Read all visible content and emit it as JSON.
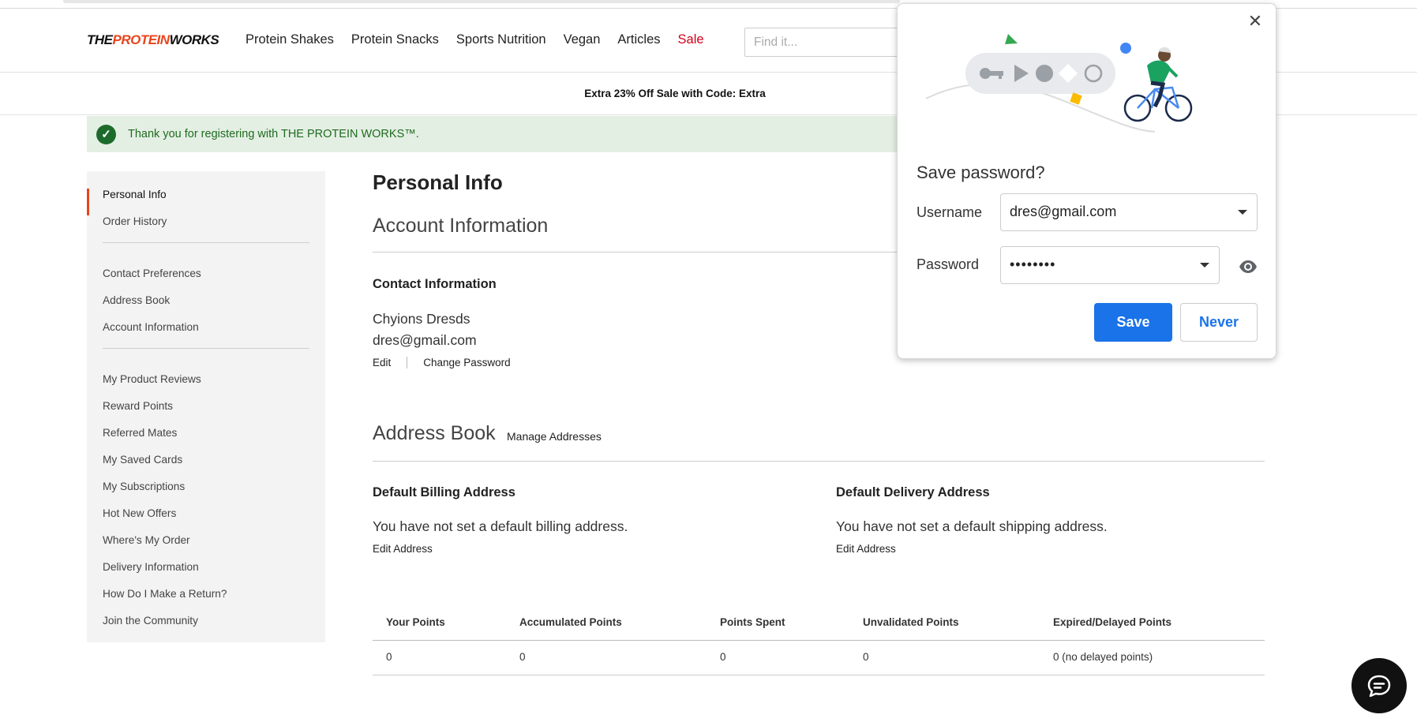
{
  "logo": {
    "part1": "THE",
    "part2": "PROTEIN",
    "part3": "WORKS"
  },
  "nav": {
    "items": [
      "Protein Shakes",
      "Protein Snacks",
      "Sports Nutrition",
      "Vegan",
      "Articles"
    ],
    "sale": "Sale"
  },
  "search": {
    "placeholder": "Find it..."
  },
  "promo": "Extra 23% Off Sale with Code: Extra",
  "success_message": "Thank you for registering with THE PROTEIN WORKS™.",
  "sidebar": {
    "group1": [
      "Personal Info",
      "Order History"
    ],
    "group2": [
      "Contact Preferences",
      "Address Book",
      "Account Information"
    ],
    "group3": [
      "My Product Reviews",
      "Reward Points",
      "Referred Mates",
      "My Saved Cards",
      "My Subscriptions",
      "Hot New Offers",
      "Where's My Order",
      "Delivery Information",
      "How Do I Make a Return?",
      "Join the Community"
    ]
  },
  "main": {
    "title": "Personal Info",
    "account_heading": "Account Information",
    "contact_heading": "Contact Information",
    "name": "Chyions Dresds",
    "email": "dres@gmail.com",
    "edit": "Edit",
    "change_password": "Change Password",
    "address_heading": "Address Book",
    "manage_addresses": "Manage Addresses",
    "billing_heading": "Default Billing Address",
    "billing_text": "You have not set a default billing address.",
    "delivery_heading": "Default Delivery Address",
    "delivery_text": "You have not set a default shipping address.",
    "edit_address": "Edit Address"
  },
  "points_table": {
    "headers": [
      "Your Points",
      "Accumulated Points",
      "Points Spent",
      "Unvalidated Points",
      "Expired/Delayed Points"
    ],
    "row": [
      "0",
      "0",
      "0",
      "0",
      "0 (no delayed points)"
    ]
  },
  "password_popup": {
    "title": "Save password?",
    "username_label": "Username",
    "username_value": "dres@gmail.com",
    "password_label": "Password",
    "password_value": "••••••••",
    "save": "Save",
    "never": "Never"
  },
  "colors": {
    "brand_orange": "#e8441d",
    "sale_red": "#d0021b",
    "success_bg": "#e4efe4",
    "success_text": "#1e6b1e",
    "chrome_blue": "#1a73e8"
  }
}
